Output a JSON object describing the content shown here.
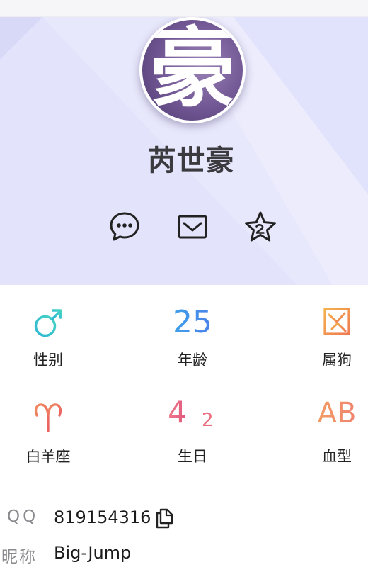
{
  "profile": {
    "avatar_char": "豪",
    "name": "芮世豪"
  },
  "actions": {
    "chat_icon": "chat-bubble-icon",
    "mail_icon": "mail-icon",
    "star_icon": "star-icon"
  },
  "attributes": [
    {
      "icon": "male-symbol-icon",
      "label": "性别"
    },
    {
      "value": "25",
      "label": "年龄"
    },
    {
      "icon": "zodiac-dog-icon",
      "label": "属狗"
    },
    {
      "icon": "aries-icon",
      "label": "白羊座"
    },
    {
      "value_month": "4",
      "value_day": "2",
      "label": "生日"
    },
    {
      "value": "AB",
      "label": "血型"
    }
  ],
  "info": {
    "qq_key": "QQ",
    "qq_value": "819154316",
    "nickname_key": "昵称",
    "nickname_value": "Big-Jump"
  },
  "colors": {
    "hero_bg": "#e3e4fb",
    "teal": "#36c2d6",
    "blue": "#3f7be8",
    "orange": "#f3a14b",
    "coral": "#ef7a5c",
    "pink": "#e7687c"
  }
}
